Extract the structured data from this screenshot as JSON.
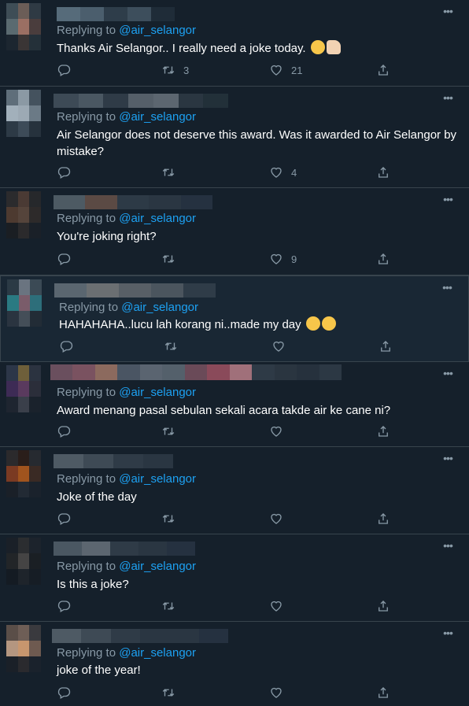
{
  "handle": "@air_selangor",
  "replying_prefix": "Replying to ",
  "more_glyph": "•••",
  "colors": {
    "background": "#15202b",
    "link": "#1da1f2",
    "muted": "#8899a6",
    "divider": "#38444d"
  },
  "icons": {
    "reply": "reply-icon",
    "retweet": "retweet-icon",
    "like": "heart-icon",
    "share": "share-icon"
  },
  "tweets": [
    {
      "text": "Thanks Air Selangor.. I really need a joke today.",
      "emoji": [
        "grinning-squinting-emoji",
        "thumbs-up-emoji"
      ],
      "retweets": "3",
      "likes": "21"
    },
    {
      "text": "Air Selangor does not deserve this award. Was it awarded to Air Selangor by mistake?",
      "emoji": [],
      "retweets": "",
      "likes": "4"
    },
    {
      "text": "You're joking right?",
      "emoji": [],
      "retweets": "",
      "likes": "9"
    },
    {
      "text": "HAHAHAHA..lucu lah korang ni..made my day",
      "emoji": [
        "rolling-laughing-emoji",
        "rolling-laughing-emoji"
      ],
      "retweets": "",
      "likes": ""
    },
    {
      "text": "Award menang pasal sebulan sekali acara takde air ke cane ni?",
      "emoji": [],
      "retweets": "",
      "likes": ""
    },
    {
      "text": "Joke of the day",
      "emoji": [],
      "retweets": "",
      "likes": ""
    },
    {
      "text": "Is this a joke?",
      "emoji": [],
      "retweets": "",
      "likes": ""
    },
    {
      "text": "joke of the year!",
      "emoji": [],
      "retweets": "",
      "likes": ""
    }
  ]
}
